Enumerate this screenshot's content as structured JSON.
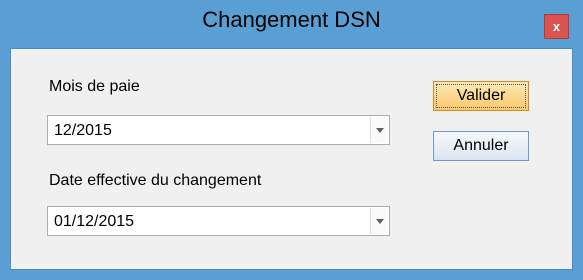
{
  "window": {
    "title": "Changement DSN",
    "close_label": "x"
  },
  "form": {
    "pay_month_label": "Mois de paie",
    "pay_month_value": "12/2015",
    "effective_date_label": "Date effective du changement",
    "effective_date_value": "01/12/2015"
  },
  "buttons": {
    "validate_label": "Valider",
    "cancel_label": "Annuler"
  },
  "colors": {
    "titlebar": "#5a9fd4",
    "close": "#d9534f",
    "primary_button": "#f8c969"
  }
}
